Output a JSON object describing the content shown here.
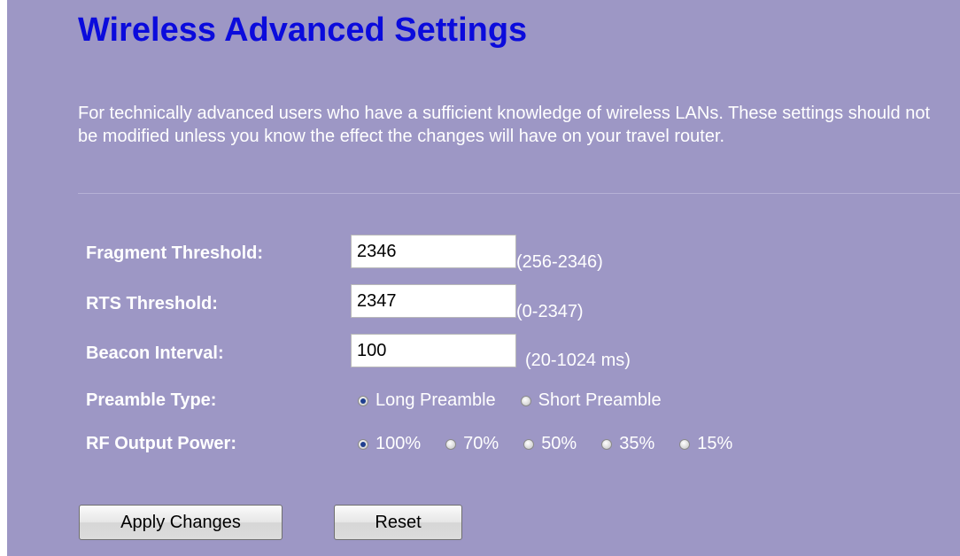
{
  "page": {
    "title": "Wireless Advanced Settings",
    "description": "For technically advanced users who have a sufficient knowledge of wireless LANs. These settings should not be modified unless you know the effect the changes will have on your travel router."
  },
  "form": {
    "fragment_threshold": {
      "label": "Fragment Threshold:",
      "value": "2346",
      "range": "(256-2346)"
    },
    "rts_threshold": {
      "label": "RTS Threshold:",
      "value": "2347",
      "range": "(0-2347)"
    },
    "beacon_interval": {
      "label": "Beacon Interval:",
      "value": "100",
      "range": "(20-1024 ms)"
    },
    "preamble_type": {
      "label": "Preamble Type:",
      "options": [
        "Long Preamble",
        "Short Preamble"
      ],
      "selected": "Long Preamble"
    },
    "rf_output_power": {
      "label": "RF Output Power:",
      "options": [
        "100%",
        "70%",
        "50%",
        "35%",
        "15%"
      ],
      "selected": "100%"
    }
  },
  "buttons": {
    "apply": "Apply Changes",
    "reset": "Reset"
  },
  "colors": {
    "panel_background": "#9d97c5",
    "title": "#0b0bdc",
    "text": "#ffffff"
  }
}
